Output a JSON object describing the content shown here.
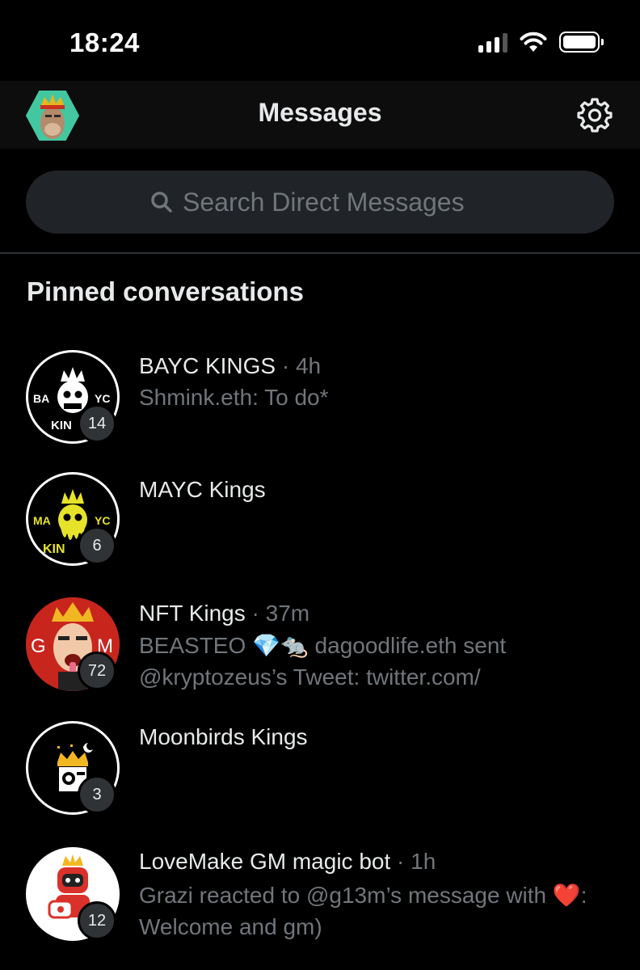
{
  "status_bar": {
    "time": "18:24"
  },
  "header": {
    "title": "Messages",
    "avatar": "profile-avatar",
    "settings_icon": "gear-icon"
  },
  "search": {
    "placeholder": "Search Direct Messages",
    "icon": "search-icon"
  },
  "section": {
    "pinned_title": "Pinned conversations"
  },
  "conversations": [
    {
      "name": "BAYC KINGS",
      "time": "· 4h",
      "preview": "Shmink.eth: To do*",
      "badge": "14",
      "avatar_text_left": "BA",
      "avatar_text_right": "YC",
      "avatar_text_bottom": "KIN"
    },
    {
      "name": "MAYC Kings",
      "time": "",
      "preview": "",
      "badge": "6",
      "avatar_text_left": "MA",
      "avatar_text_right": "YC",
      "avatar_text_bottom": "KIN"
    },
    {
      "name": "NFT Kings",
      "time": "· 37m",
      "preview_parts": [
        "BEASTEO 💎🐀 dagoodlife.eth sent",
        "@kryptozeus’s Tweet: twitter.com/"
      ],
      "badge": "72",
      "avatar_text_left": "G",
      "avatar_text_right": "M"
    },
    {
      "name": "Moonbirds Kings",
      "time": "",
      "preview": "",
      "badge": "3"
    },
    {
      "name": "LoveMake GM magic bot",
      "time": "· 1h",
      "preview_parts": [
        "Grazi reacted to @g13m’s message with",
        "❤️",
        ":",
        "Welcome and gm)"
      ],
      "badge": "12"
    }
  ],
  "colors": {
    "background": "#000000",
    "text": "#e7e9ea",
    "muted": "#71767b",
    "search_bg": "#202327",
    "badge_bg": "#2f3336"
  }
}
